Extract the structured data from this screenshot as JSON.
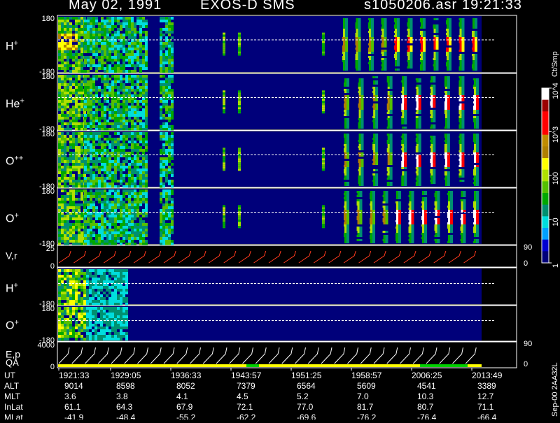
{
  "header": {
    "date": "May 02, 1991",
    "instrument": "EXOS-D SMS",
    "file": "s1050206.asr",
    "time": "19:21:33"
  },
  "colorbar": {
    "unit": "Ct/Smp",
    "ticks": [
      {
        "label": "1",
        "value": 1
      },
      {
        "label": "10",
        "value": 10
      },
      {
        "label": "100",
        "value": 100
      },
      {
        "label": "10^3",
        "value": 1000
      },
      {
        "label": "10^4",
        "value": 10000
      }
    ],
    "colors": [
      "#00007a",
      "#0000d0",
      "#00a0ff",
      "#00dddd",
      "#009070",
      "#00a800",
      "#55c000",
      "#b0e000",
      "#ffff00",
      "#b08000",
      "#c08c00",
      "#ff0000",
      "#ff0000",
      "#9c0000",
      "#ffffff"
    ]
  },
  "colors": {
    "background": "#00007a",
    "trace": "#ff3b1f",
    "line": "#ffffff",
    "qa_yellow": "#ffff00",
    "qa_green": "#00d000"
  },
  "panels": [
    {
      "id": "h-plus",
      "species": "H",
      "charge": "+",
      "ytop": "180",
      "ybottom": "-180"
    },
    {
      "id": "he-plus",
      "species": "He",
      "charge": "+",
      "ytop": "180",
      "ybottom": "-180"
    },
    {
      "id": "o-plus-plus",
      "species": "O",
      "charge": "++",
      "ytop": "180",
      "ybottom": "-180"
    },
    {
      "id": "o-plus",
      "species": "O",
      "charge": "+",
      "ytop": "180",
      "ybottom": "-180"
    },
    {
      "id": "vr",
      "species": "V,r",
      "charge": "",
      "ytop": "25",
      "ybottom": "0",
      "right_top": "90",
      "right_bottom": "0"
    },
    {
      "id": "h-plus-2",
      "species": "H",
      "charge": "+",
      "ytop": "",
      "ybottom": "-180"
    },
    {
      "id": "o-plus-2",
      "species": "O",
      "charge": "+",
      "ytop": "180",
      "ybottom": "-180"
    },
    {
      "id": "ep",
      "species": "E,p",
      "charge": "",
      "ytop": "4000",
      "ybottom": "0",
      "right_top": "90",
      "right_bottom": "0"
    }
  ],
  "qa_label": "QA",
  "side_text": "Sep-00  2AA32L",
  "ephemeris": {
    "rows": [
      {
        "label": "UT",
        "values": [
          "1921:33",
          "1929:05",
          "1936:33",
          "1943:57",
          "1951:25",
          "1958:57",
          "2006:25",
          "2013:49"
        ]
      },
      {
        "label": "ALT",
        "values": [
          "9014",
          "8598",
          "8052",
          "7379",
          "6564",
          "5609",
          "4541",
          "3389"
        ]
      },
      {
        "label": "MLT",
        "values": [
          "3.6",
          "3.8",
          "4.1",
          "4.5",
          "5.2",
          "7.0",
          "10.3",
          "12.7"
        ]
      },
      {
        "label": "InLat",
        "values": [
          "61.1",
          "64.3",
          "67.9",
          "72.1",
          "77.0",
          "81.7",
          "80.7",
          "71.1"
        ]
      },
      {
        "label": "MLat",
        "values": [
          "-41.9",
          "-48.4",
          "-55.2",
          "-62.2",
          "-69.6",
          "-76.2",
          "-76.4",
          "-66.4"
        ]
      }
    ]
  },
  "chart_data": {
    "type": "heatmap",
    "x_ticks_ut": [
      "1921:33",
      "1929:05",
      "1936:33",
      "1943:57",
      "1951:25",
      "1958:57",
      "2006:25",
      "2013:49"
    ],
    "pitch_angle_range": [
      -180,
      180
    ],
    "data_gaps_ut": [],
    "colorbar_unit": "Ct/Smp",
    "colorbar_scale": "log",
    "colorbar_range": [
      1,
      10000
    ],
    "series": [
      {
        "name": "H+",
        "spin_bursts": 11,
        "peak_color": "red"
      },
      {
        "name": "He+",
        "spin_bursts": 10,
        "peak_color": "white"
      },
      {
        "name": "O++",
        "spin_bursts": 10,
        "peak_color": "white"
      },
      {
        "name": "O+",
        "spin_bursts": 11,
        "peak_color": "white"
      }
    ],
    "vr_range": [
      0,
      25
    ],
    "ep_range": [
      0,
      4000
    ]
  }
}
